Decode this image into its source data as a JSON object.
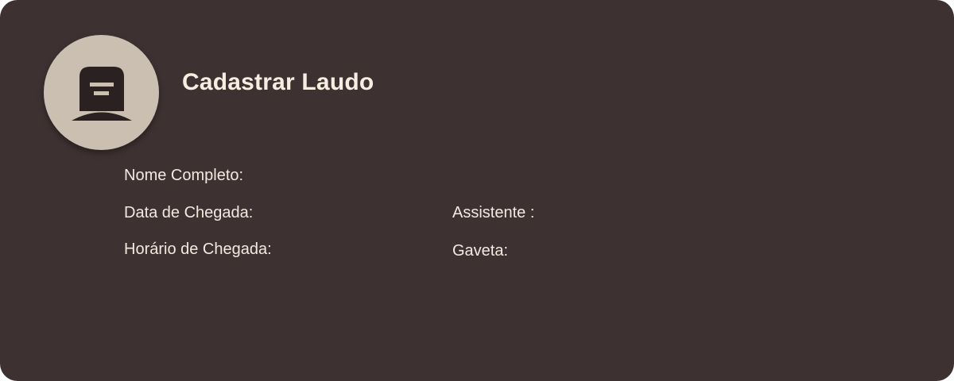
{
  "card": {
    "icon": "tombstone-icon",
    "title": "Cadastrar Laudo",
    "fields": {
      "nome_completo": "Nome Completo:",
      "data_chegada": "Data de Chegada:",
      "horario_chegada": "Horário de Chegada:",
      "assistente": "Assistente :",
      "gaveta": "Gaveta:"
    }
  },
  "colors": {
    "card_background": "#3e3131",
    "avatar_background": "#cbbfb1",
    "icon_color": "#2b2121",
    "text_color": "#f6ece2"
  }
}
